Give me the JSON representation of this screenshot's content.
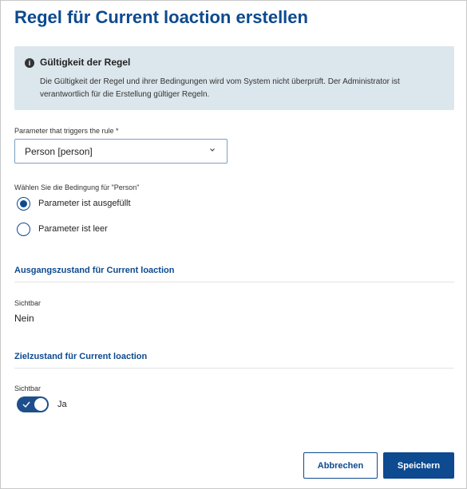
{
  "dialog": {
    "title": "Regel für Current loaction erstellen"
  },
  "info": {
    "icon": "info-icon",
    "title": "Gültigkeit der Regel",
    "text": "Die Gültigkeit der Regel und ihrer Bedingungen wird vom System nicht überprüft. Der Administrator ist verantwortlich für die Erstellung gültiger Regeln."
  },
  "parameter": {
    "label": "Parameter that triggers the rule *",
    "value": "Person [person]"
  },
  "condition": {
    "label": "Wählen Sie die Bedingung für \"Person\"",
    "options": [
      {
        "label": "Parameter ist ausgefüllt",
        "checked": true
      },
      {
        "label": "Parameter ist leer",
        "checked": false
      }
    ]
  },
  "initial_state": {
    "heading": "Ausgangszustand für Current loaction",
    "visible_label": "Sichtbar",
    "visible_value": "Nein"
  },
  "target_state": {
    "heading": "Zielzustand für Current loaction",
    "visible_label": "Sichtbar",
    "toggle_label": "Ja",
    "toggle_on": true
  },
  "buttons": {
    "cancel": "Abbrechen",
    "save": "Speichern"
  },
  "colors": {
    "primary": "#0d4a8f",
    "info_bg": "#dce6ed"
  }
}
